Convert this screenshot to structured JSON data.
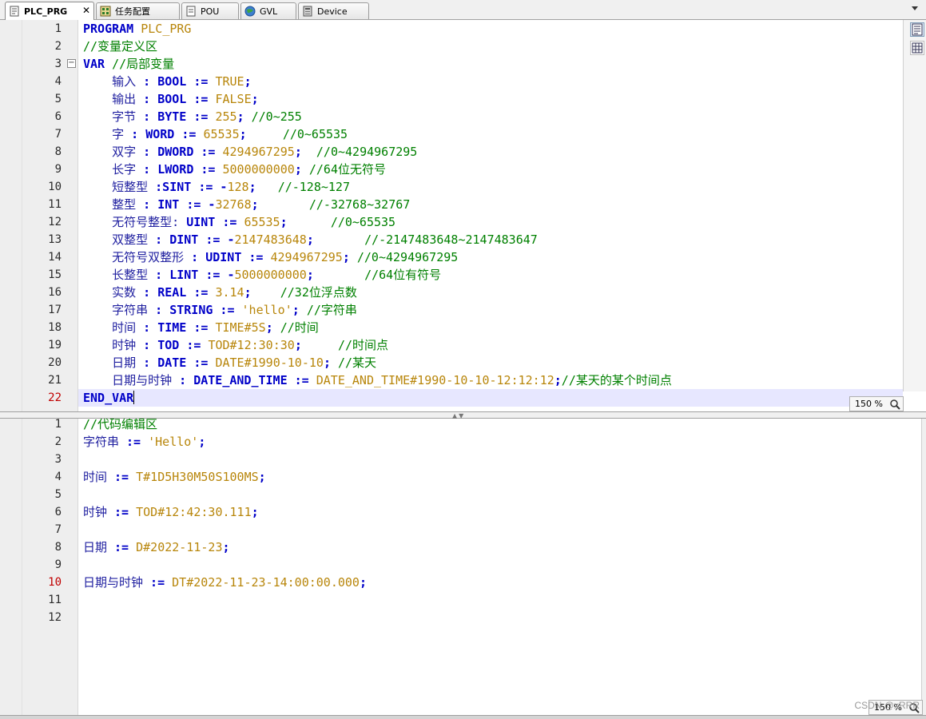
{
  "tabs": [
    {
      "label": "PLC_PRG",
      "icon": "program-icon",
      "active": true,
      "closable": true
    },
    {
      "label": "任务配置",
      "icon": "task-config-icon",
      "active": false
    },
    {
      "label": "POU",
      "icon": "pou-icon",
      "active": false
    },
    {
      "label": "GVL",
      "icon": "gvl-icon",
      "active": false
    },
    {
      "label": "Device",
      "icon": "device-icon",
      "active": false
    }
  ],
  "declaration_editor": {
    "zoom": "150 %",
    "current_line": 22,
    "lines": [
      {
        "n": "1",
        "segs": [
          [
            "kw",
            "PROGRAM "
          ],
          [
            "lit",
            "PLC_PRG"
          ]
        ]
      },
      {
        "n": "2",
        "segs": [
          [
            "cm",
            "//变量定义区"
          ]
        ]
      },
      {
        "n": "3",
        "segs": [
          [
            "kw",
            "VAR "
          ],
          [
            "cm",
            "//局部变量"
          ]
        ]
      },
      {
        "n": "4",
        "segs": [
          [
            "id",
            "    输入 "
          ],
          [
            "op",
            ": BOOL := "
          ],
          [
            "lit",
            "TRUE"
          ],
          [
            "op",
            ";"
          ]
        ]
      },
      {
        "n": "5",
        "segs": [
          [
            "id",
            "    输出 "
          ],
          [
            "op",
            ": BOOL := "
          ],
          [
            "lit",
            "FALSE"
          ],
          [
            "op",
            ";"
          ]
        ]
      },
      {
        "n": "6",
        "segs": [
          [
            "id",
            "    字节 "
          ],
          [
            "op",
            ": BYTE := "
          ],
          [
            "lit",
            "255"
          ],
          [
            "op",
            "; "
          ],
          [
            "cm",
            "//0~255"
          ]
        ]
      },
      {
        "n": "7",
        "segs": [
          [
            "id",
            "    字 "
          ],
          [
            "op",
            ": WORD := "
          ],
          [
            "lit",
            "65535"
          ],
          [
            "op",
            ";     "
          ],
          [
            "cm",
            "//0~65535"
          ]
        ]
      },
      {
        "n": "8",
        "segs": [
          [
            "id",
            "    双字 "
          ],
          [
            "op",
            ": DWORD := "
          ],
          [
            "lit",
            "4294967295"
          ],
          [
            "op",
            ";  "
          ],
          [
            "cm",
            "//0~4294967295"
          ]
        ]
      },
      {
        "n": "9",
        "segs": [
          [
            "id",
            "    长字 "
          ],
          [
            "op",
            ": LWORD := "
          ],
          [
            "lit",
            "5000000000"
          ],
          [
            "op",
            "; "
          ],
          [
            "cm",
            "//64位无符号"
          ]
        ]
      },
      {
        "n": "10",
        "segs": [
          [
            "id",
            "    短整型 "
          ],
          [
            "op",
            ":SINT := -"
          ],
          [
            "lit",
            "128"
          ],
          [
            "op",
            ";   "
          ],
          [
            "cm",
            "//-128~127"
          ]
        ]
      },
      {
        "n": "11",
        "segs": [
          [
            "id",
            "    整型 "
          ],
          [
            "op",
            ": INT := -"
          ],
          [
            "lit",
            "32768"
          ],
          [
            "op",
            ";       "
          ],
          [
            "cm",
            "//-32768~32767"
          ]
        ]
      },
      {
        "n": "12",
        "segs": [
          [
            "id",
            "    无符号整型: "
          ],
          [
            "op",
            "UINT := "
          ],
          [
            "lit",
            "65535"
          ],
          [
            "op",
            ";      "
          ],
          [
            "cm",
            "//0~65535"
          ]
        ]
      },
      {
        "n": "13",
        "segs": [
          [
            "id",
            "    双整型 "
          ],
          [
            "op",
            ": DINT := -"
          ],
          [
            "lit",
            "2147483648"
          ],
          [
            "op",
            ";       "
          ],
          [
            "cm",
            "//-2147483648~2147483647"
          ]
        ]
      },
      {
        "n": "14",
        "segs": [
          [
            "id",
            "    无符号双整形 "
          ],
          [
            "op",
            ": UDINT := "
          ],
          [
            "lit",
            "4294967295"
          ],
          [
            "op",
            "; "
          ],
          [
            "cm",
            "//0~4294967295"
          ]
        ]
      },
      {
        "n": "15",
        "segs": [
          [
            "id",
            "    长整型 "
          ],
          [
            "op",
            ": LINT := -"
          ],
          [
            "lit",
            "5000000000"
          ],
          [
            "op",
            ";       "
          ],
          [
            "cm",
            "//64位有符号"
          ]
        ]
      },
      {
        "n": "16",
        "segs": [
          [
            "id",
            "    实数 "
          ],
          [
            "op",
            ": REAL := "
          ],
          [
            "lit",
            "3.14"
          ],
          [
            "op",
            ";    "
          ],
          [
            "cm",
            "//32位浮点数"
          ]
        ]
      },
      {
        "n": "17",
        "segs": [
          [
            "id",
            "    字符串 "
          ],
          [
            "op",
            ": STRING := "
          ],
          [
            "lit",
            "'hello'"
          ],
          [
            "op",
            "; "
          ],
          [
            "cm",
            "//字符串"
          ]
        ]
      },
      {
        "n": "18",
        "segs": [
          [
            "id",
            "    时间 "
          ],
          [
            "op",
            ": TIME := "
          ],
          [
            "lit",
            "TIME#5S"
          ],
          [
            "op",
            "; "
          ],
          [
            "cm",
            "//时间"
          ]
        ]
      },
      {
        "n": "19",
        "segs": [
          [
            "id",
            "    时钟 "
          ],
          [
            "op",
            ": TOD := "
          ],
          [
            "lit",
            "TOD#12:30:30"
          ],
          [
            "op",
            ";     "
          ],
          [
            "cm",
            "//时间点"
          ]
        ]
      },
      {
        "n": "20",
        "segs": [
          [
            "id",
            "    日期 "
          ],
          [
            "op",
            ": DATE := "
          ],
          [
            "lit",
            "DATE#1990-10-10"
          ],
          [
            "op",
            "; "
          ],
          [
            "cm",
            "//某天"
          ]
        ]
      },
      {
        "n": "21",
        "segs": [
          [
            "id",
            "    日期与时钟 "
          ],
          [
            "op",
            ": DATE_AND_TIME := "
          ],
          [
            "lit",
            "DATE_AND_TIME#1990-10-10-12:12:12"
          ],
          [
            "op",
            ";"
          ],
          [
            "cm",
            "//某天的某个时间点"
          ]
        ]
      },
      {
        "n": "22",
        "segs": [
          [
            "kw",
            "END_VAR"
          ]
        ]
      }
    ]
  },
  "implementation_editor": {
    "zoom": "150 %",
    "current_line": 10,
    "lines": [
      {
        "n": "1",
        "segs": [
          [
            "cm",
            "//代码编辑区"
          ]
        ]
      },
      {
        "n": "2",
        "segs": [
          [
            "id",
            "字符串 "
          ],
          [
            "op",
            ":= "
          ],
          [
            "lit",
            "'Hello'"
          ],
          [
            "op",
            ";"
          ]
        ]
      },
      {
        "n": "3",
        "segs": []
      },
      {
        "n": "4",
        "segs": [
          [
            "id",
            "时间 "
          ],
          [
            "op",
            ":= "
          ],
          [
            "lit",
            "T#1D5H30M50S100MS"
          ],
          [
            "op",
            ";"
          ]
        ]
      },
      {
        "n": "5",
        "segs": []
      },
      {
        "n": "6",
        "segs": [
          [
            "id",
            "时钟 "
          ],
          [
            "op",
            ":= "
          ],
          [
            "lit",
            "TOD#12:42:30.111"
          ],
          [
            "op",
            ";"
          ]
        ]
      },
      {
        "n": "7",
        "segs": []
      },
      {
        "n": "8",
        "segs": [
          [
            "id",
            "日期 "
          ],
          [
            "op",
            ":= "
          ],
          [
            "lit",
            "D#2022-11-23"
          ],
          [
            "op",
            ";"
          ]
        ]
      },
      {
        "n": "9",
        "segs": []
      },
      {
        "n": "10",
        "segs": [
          [
            "id",
            "日期与时钟 "
          ],
          [
            "op",
            ":= "
          ],
          [
            "lit",
            "DT#2022-11-23-14:00:00.000"
          ],
          [
            "op",
            ";"
          ]
        ]
      },
      {
        "n": "11",
        "segs": []
      },
      {
        "n": "12",
        "segs": []
      }
    ]
  },
  "watermark": "CSDN @xRRR"
}
